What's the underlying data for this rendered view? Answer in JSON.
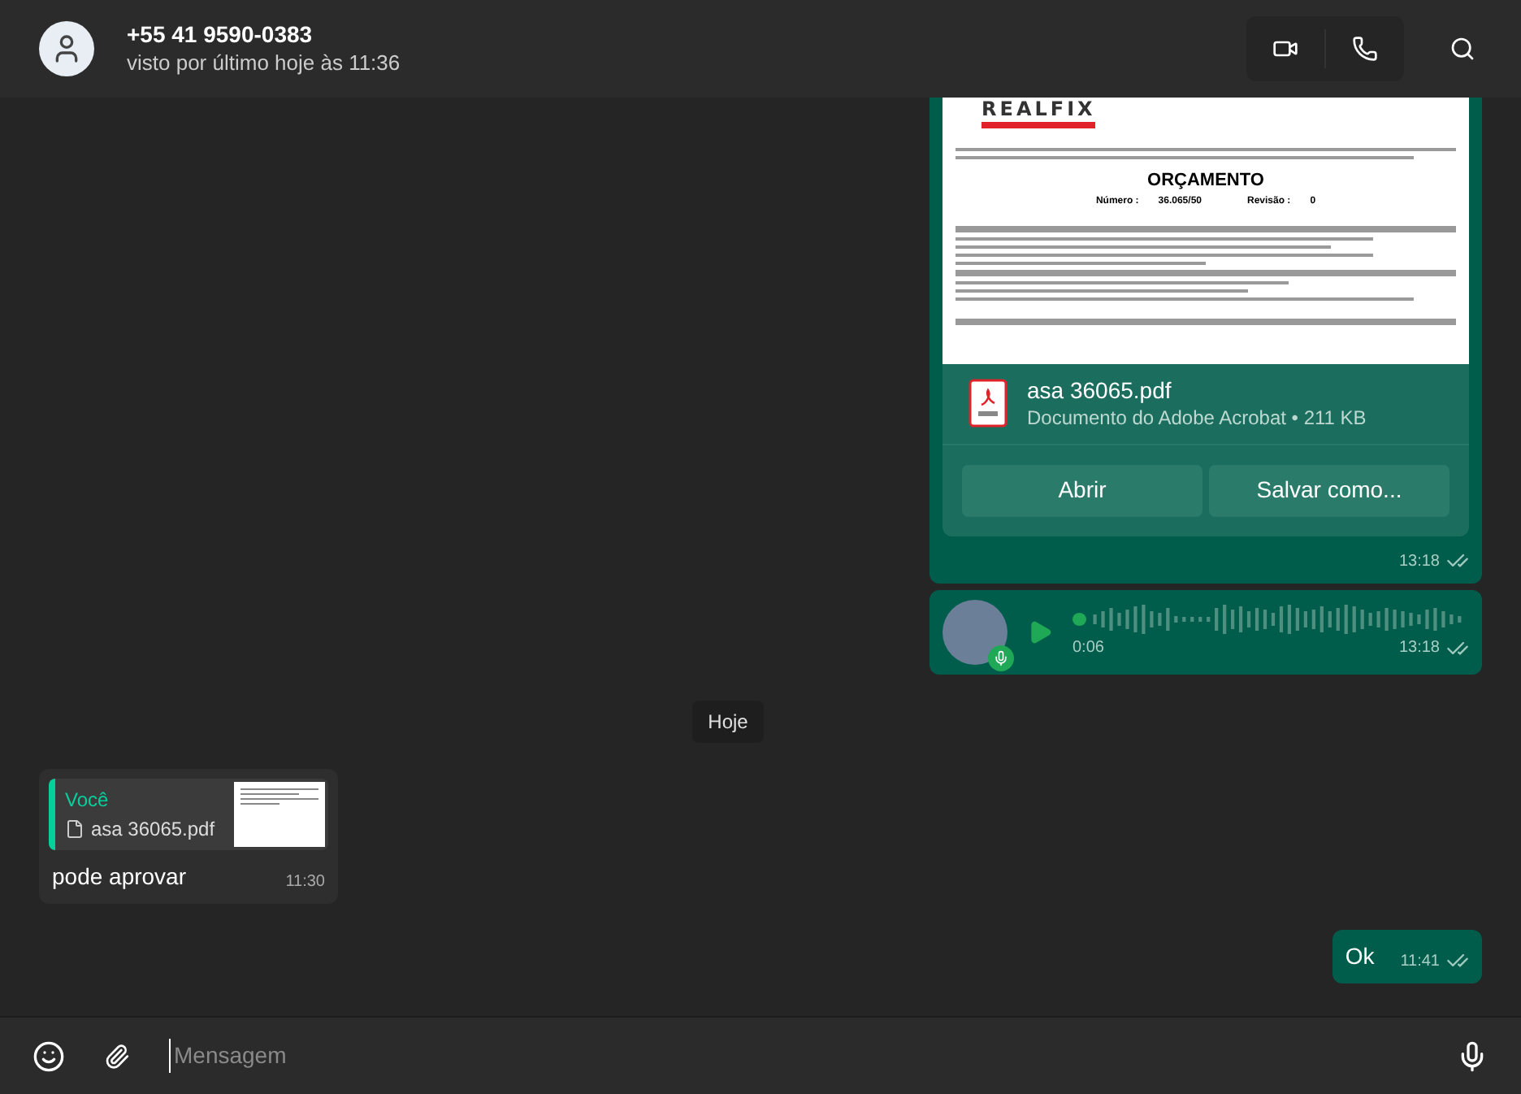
{
  "header": {
    "name": "+55 41 9590-0383",
    "status": "visto por último hoje às 11:36"
  },
  "messages": [
    {
      "kind": "document",
      "outgoing": true,
      "preview": {
        "logo": "REALFIX",
        "title": "ORÇAMENTO",
        "number_label": "Número :",
        "number": "36.065/50",
        "revision_label": "Revisão :",
        "revision": "0"
      },
      "file_name": "asa 36065.pdf",
      "file_info": "Documento do Adobe Acrobat • 211 KB",
      "actions": [
        "Abrir",
        "Salvar como..."
      ],
      "time": "13:18"
    },
    {
      "kind": "voice",
      "outgoing": true,
      "duration": "0:06",
      "time": "13:18"
    },
    {
      "kind": "date",
      "text": "Hoje"
    },
    {
      "kind": "reply",
      "outgoing": false,
      "quote_author": "Você",
      "quote_file": "asa 36065.pdf",
      "text": "pode aprovar",
      "time": "11:30"
    },
    {
      "kind": "text",
      "outgoing": true,
      "text": "Ok",
      "time": "11:41"
    }
  ],
  "composer": {
    "placeholder": "Mensagem"
  }
}
